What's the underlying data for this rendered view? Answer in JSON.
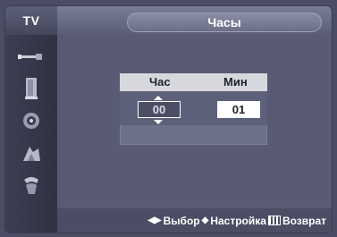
{
  "sidebar": {
    "title": "TV",
    "items": [
      {
        "icon": "antenna-icon"
      },
      {
        "icon": "picture-icon"
      },
      {
        "icon": "sound-icon"
      },
      {
        "icon": "channel-icon"
      },
      {
        "icon": "setup-icon"
      }
    ]
  },
  "header": {
    "title": "Часы"
  },
  "clock": {
    "hour_label": "Час",
    "minute_label": "Мин",
    "hour_value": "00",
    "minute_value": "01"
  },
  "help": {
    "select_label": "Выбор",
    "adjust_label": "Настройка",
    "return_label": "Возврат"
  },
  "colors": {
    "background": "#585b73",
    "sidebar": "#2f3242",
    "header_band": "#d7d8de",
    "text": "#ffffff"
  }
}
